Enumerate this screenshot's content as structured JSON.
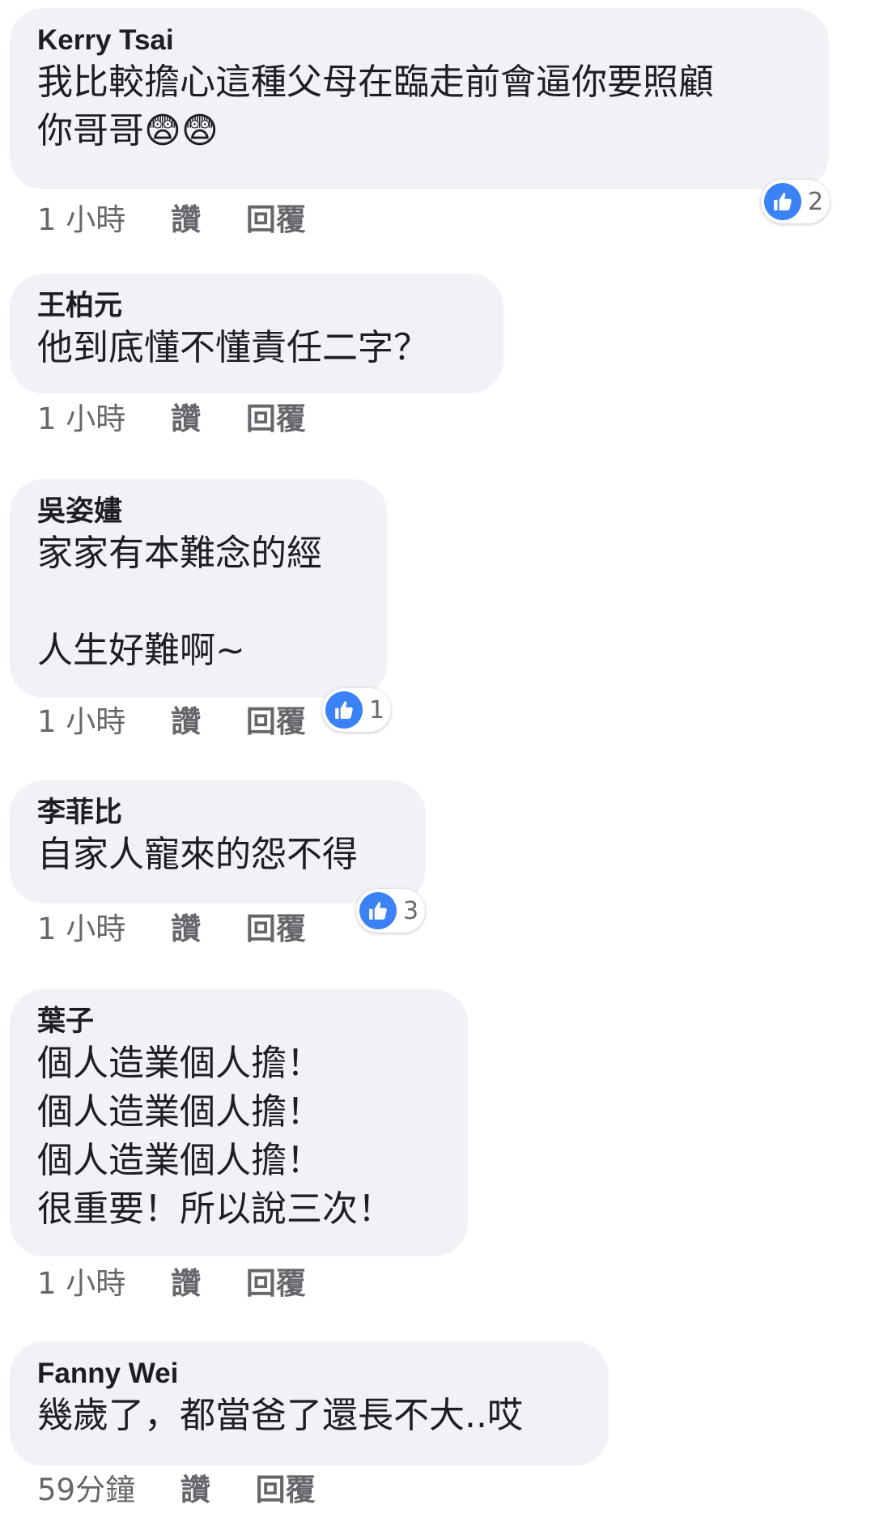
{
  "comments": [
    {
      "author": "Kerry Tsai",
      "text_line1": "我比較擔心這種父母在臨走前會逼你要照顧",
      "text_line2": "你哥哥",
      "emojis": "😨😨",
      "time": "1 小時",
      "like": "讚",
      "reply": "回覆",
      "reactions": "2"
    },
    {
      "author": "王柏元",
      "text": "他到底懂不懂責任二字？",
      "time": "1 小時",
      "like": "讚",
      "reply": "回覆"
    },
    {
      "author": "吳姿嫿",
      "text": "家家有本難念的經\n\n人生好難啊~",
      "time": "1 小時",
      "like": "讚",
      "reply": "回覆",
      "reactions": "1"
    },
    {
      "author": "李菲比",
      "text": "自家人寵來的怨不得",
      "time": "1 小時",
      "like": "讚",
      "reply": "回覆",
      "reactions": "3"
    },
    {
      "author": "葉子",
      "text": "個人造業個人擔！\n個人造業個人擔！\n個人造業個人擔！\n很重要！所以說三次！",
      "time": "1 小時",
      "like": "讚",
      "reply": "回覆"
    },
    {
      "author": "Fanny Wei",
      "text": "幾歲了，都當爸了還長不大..哎",
      "time": "59分鐘",
      "like": "讚",
      "reply": "回覆"
    }
  ],
  "colors": {
    "bubble_bg": "#f0f2f5",
    "meta_text": "#65676b",
    "like_blue": "#3b82f6"
  },
  "icons": {
    "reaction": "thumbs-up-icon"
  }
}
